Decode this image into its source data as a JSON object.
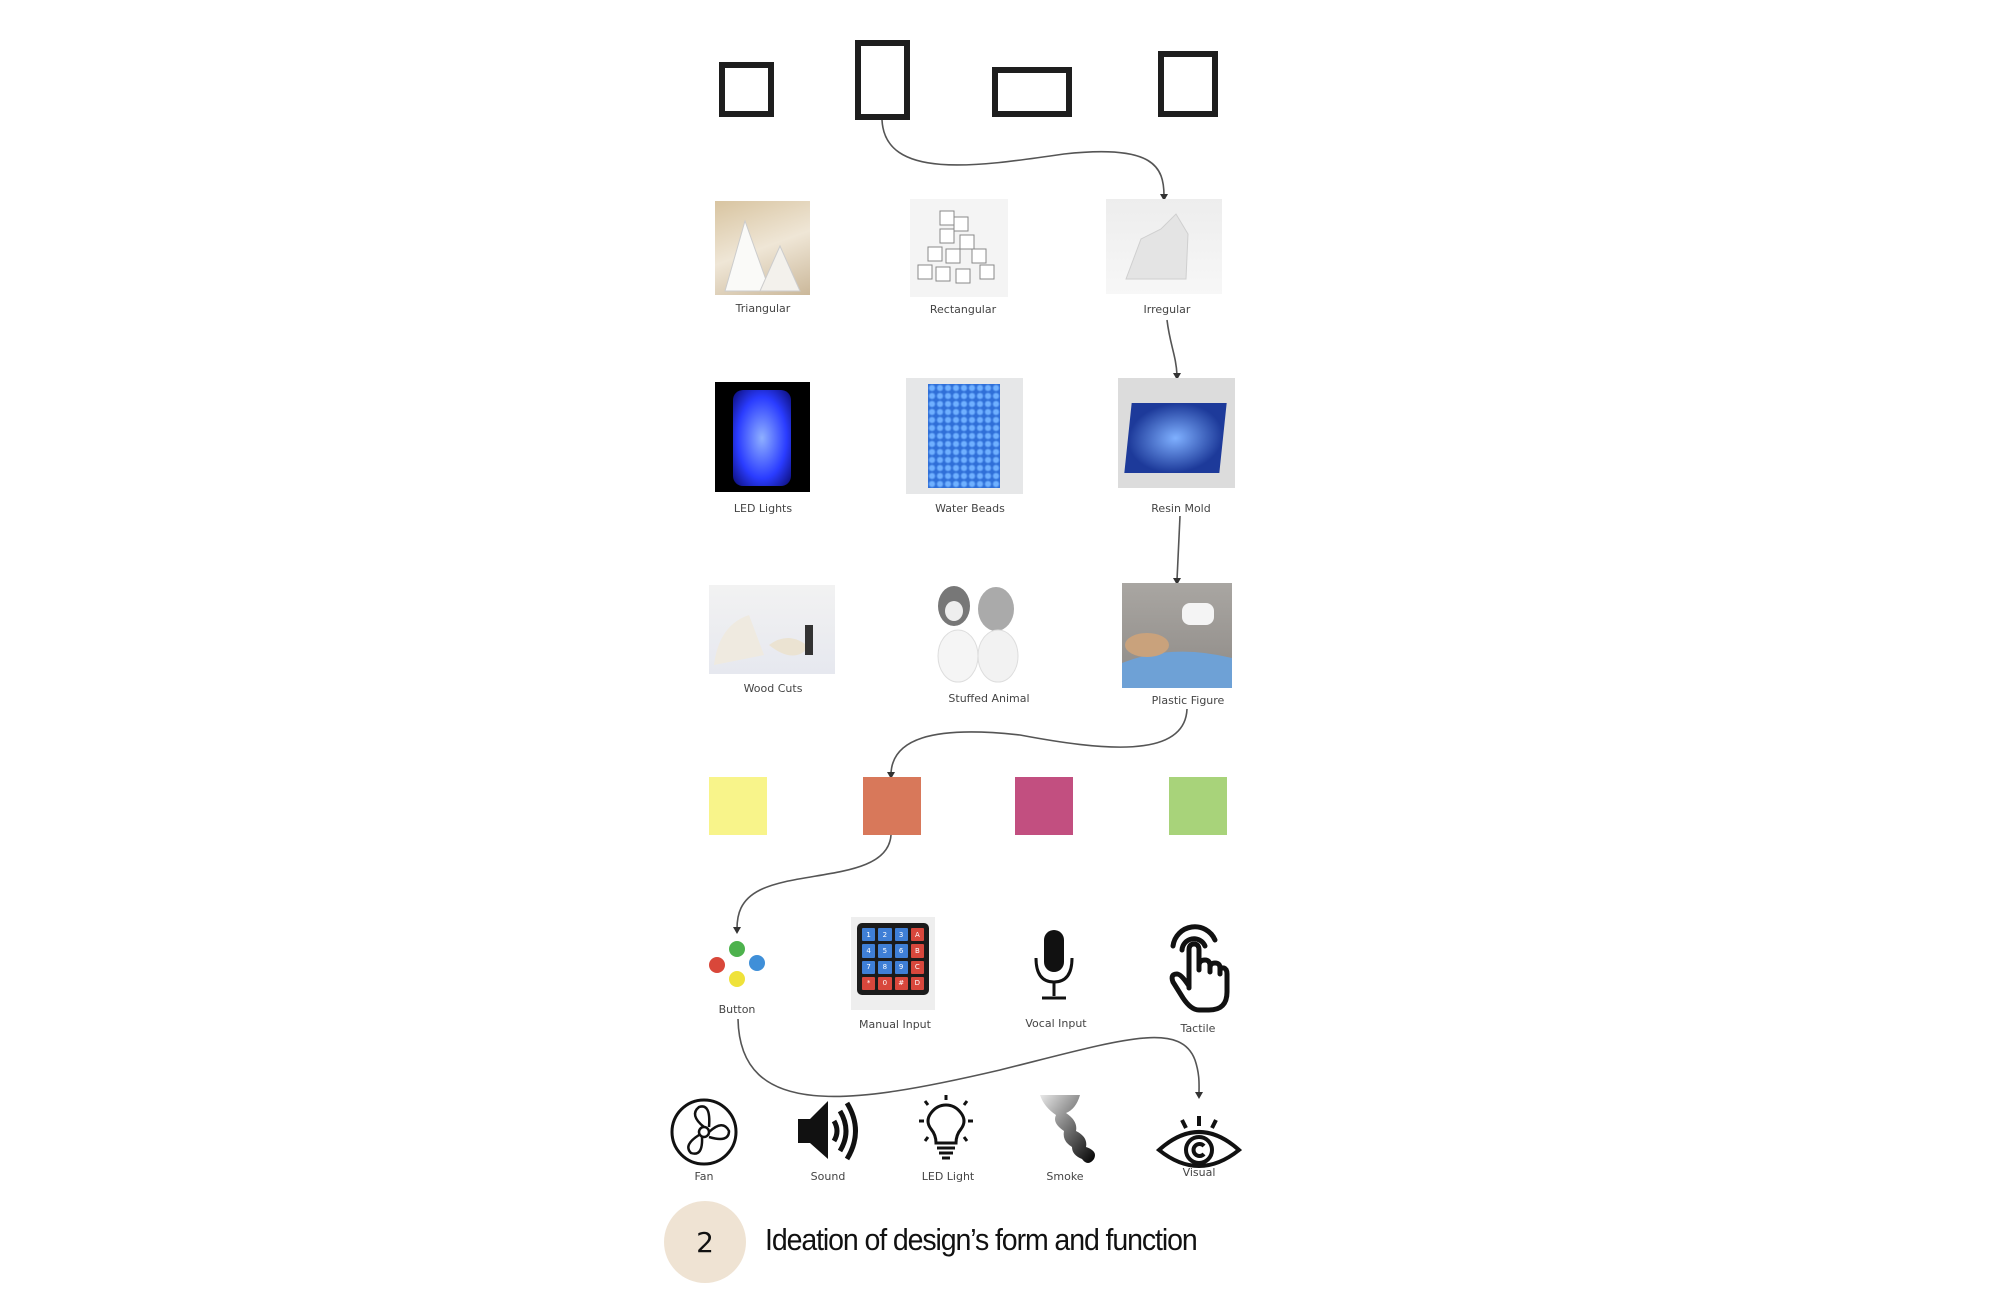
{
  "form_shapes": [
    "square",
    "tall-rectangle",
    "wide-rectangle",
    "square"
  ],
  "shape_labels": [
    "Triangular",
    "Rectangular",
    "Irregular"
  ],
  "material_labels": [
    "LED Lights",
    "Water Beads",
    "Resin Mold"
  ],
  "object_labels": [
    "Wood Cuts",
    "Stuffed Animal",
    "Plastic Figure"
  ],
  "colors": [
    "#f8f48a",
    "#d8785a",
    "#c24f80",
    "#a8d37a"
  ],
  "input_labels": [
    "Button",
    "Manual Input",
    "Vocal Input",
    "Tactile"
  ],
  "keypad_keys": [
    "1",
    "2",
    "3",
    "A",
    "4",
    "5",
    "6",
    "B",
    "7",
    "8",
    "9",
    "C",
    "*",
    "0",
    "#",
    "D"
  ],
  "output_labels": [
    "Fan",
    "Sound",
    "LED Light",
    "Smoke",
    "Visual"
  ],
  "caption": {
    "number": "2",
    "text": "Ideation of design’s form and function"
  },
  "badge_color": "#efe3d3"
}
